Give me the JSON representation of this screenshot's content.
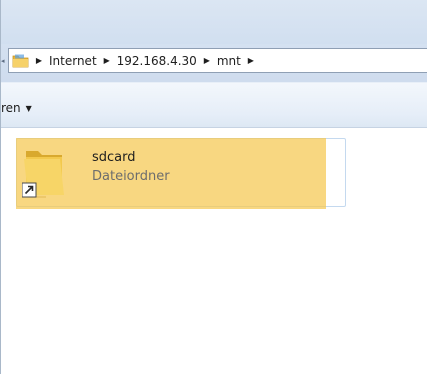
{
  "address_bar": {
    "breadcrumbs": [
      {
        "label": "Internet"
      },
      {
        "label": "192.168.4.30"
      },
      {
        "label": "mnt"
      }
    ]
  },
  "toolbar": {
    "organize_label": "ren"
  },
  "file_list": {
    "items": [
      {
        "name": "sdcard",
        "type": "Dateiordner",
        "icon": "folder-shortcut-icon",
        "highlighted": true
      }
    ]
  },
  "colors": {
    "highlight": "#f5c850",
    "folder": "#f0c64a",
    "titlebar": "#dbe6f3"
  }
}
